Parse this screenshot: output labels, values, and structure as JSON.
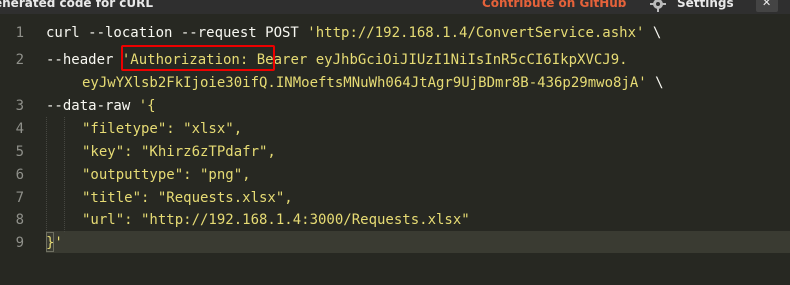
{
  "topbar": {
    "title": "enerated code for cURL",
    "github_link": "Contribute on GitHub",
    "settings_label": "Settings",
    "close_icon": "close-icon",
    "settings_icon": "gear-icon"
  },
  "editor": {
    "theme_colors": {
      "background": "#272822",
      "text": "#f8f8f2",
      "string": "#e6db74",
      "line_number": "#8f908a",
      "highlight_box": "#e00000"
    },
    "line_numbers": [
      "1",
      "2",
      "3",
      "4",
      "5",
      "6",
      "7",
      "8",
      "9"
    ],
    "line1": {
      "cmd": "curl --location --request POST ",
      "url": "'http://192.168.1.4/ConvertService.ashx'",
      "cont": " \\"
    },
    "line2": {
      "flag": "--header ",
      "header_name": "'Authorization:",
      "header_value_a": " Bearer eyJhbGciOiJIUzI1NiIsInR5cCI6IkpXVCJ9.",
      "header_value_b": "eyJwYXlsb2FkIjoie30ifQ.INMoeftsMNuWh064JtAgr9UjBDmr8B-436p29mwo8jA'",
      "cont": " \\"
    },
    "line3": {
      "flag": "--data-raw ",
      "open": "'{"
    },
    "line4": "\"filetype\": \"xlsx\",",
    "line5": "\"key\": \"Khirz6zTPdafr\",",
    "line6": "\"outputtype\": \"png\",",
    "line7": "\"title\": \"Requests.xlsx\",",
    "line8": "\"url\": \"http://192.168.1.4:3000/Requests.xlsx\"",
    "line9": "}'"
  }
}
